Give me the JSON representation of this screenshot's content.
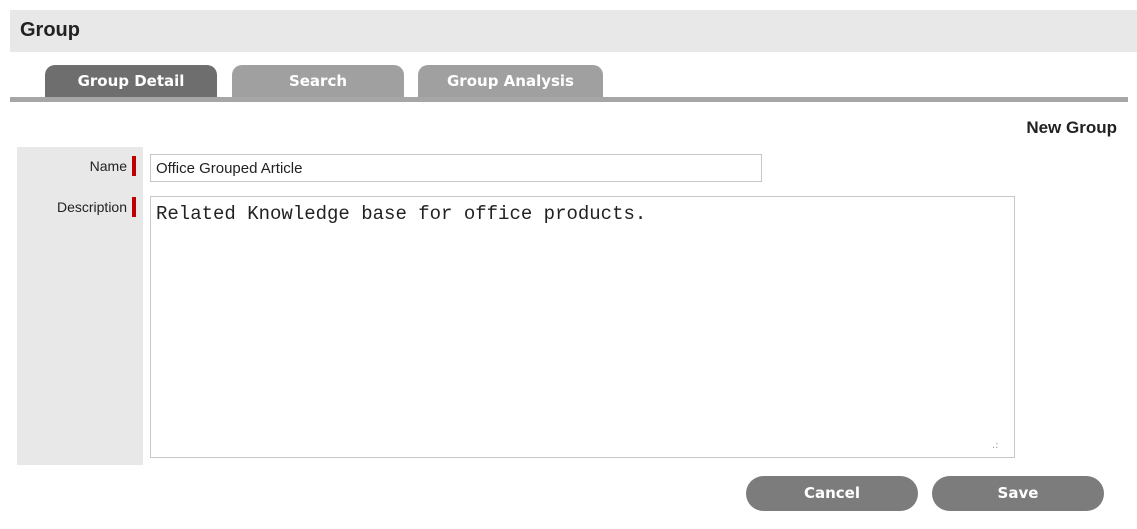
{
  "header": {
    "title": "Group"
  },
  "tabs": [
    {
      "label": "Group Detail",
      "active": true
    },
    {
      "label": "Search",
      "active": false
    },
    {
      "label": "Group Analysis",
      "active": false
    }
  ],
  "form": {
    "subtitle": "New Group",
    "name_label": "Name",
    "name_value": "Office Grouped Article",
    "description_label": "Description",
    "description_value": "Related Knowledge base for office products.",
    "required_indicator_color": "#c00000"
  },
  "actions": {
    "cancel_label": "Cancel",
    "save_label": "Save"
  },
  "icons": {
    "resize_grip": "resize-grip-icon"
  }
}
